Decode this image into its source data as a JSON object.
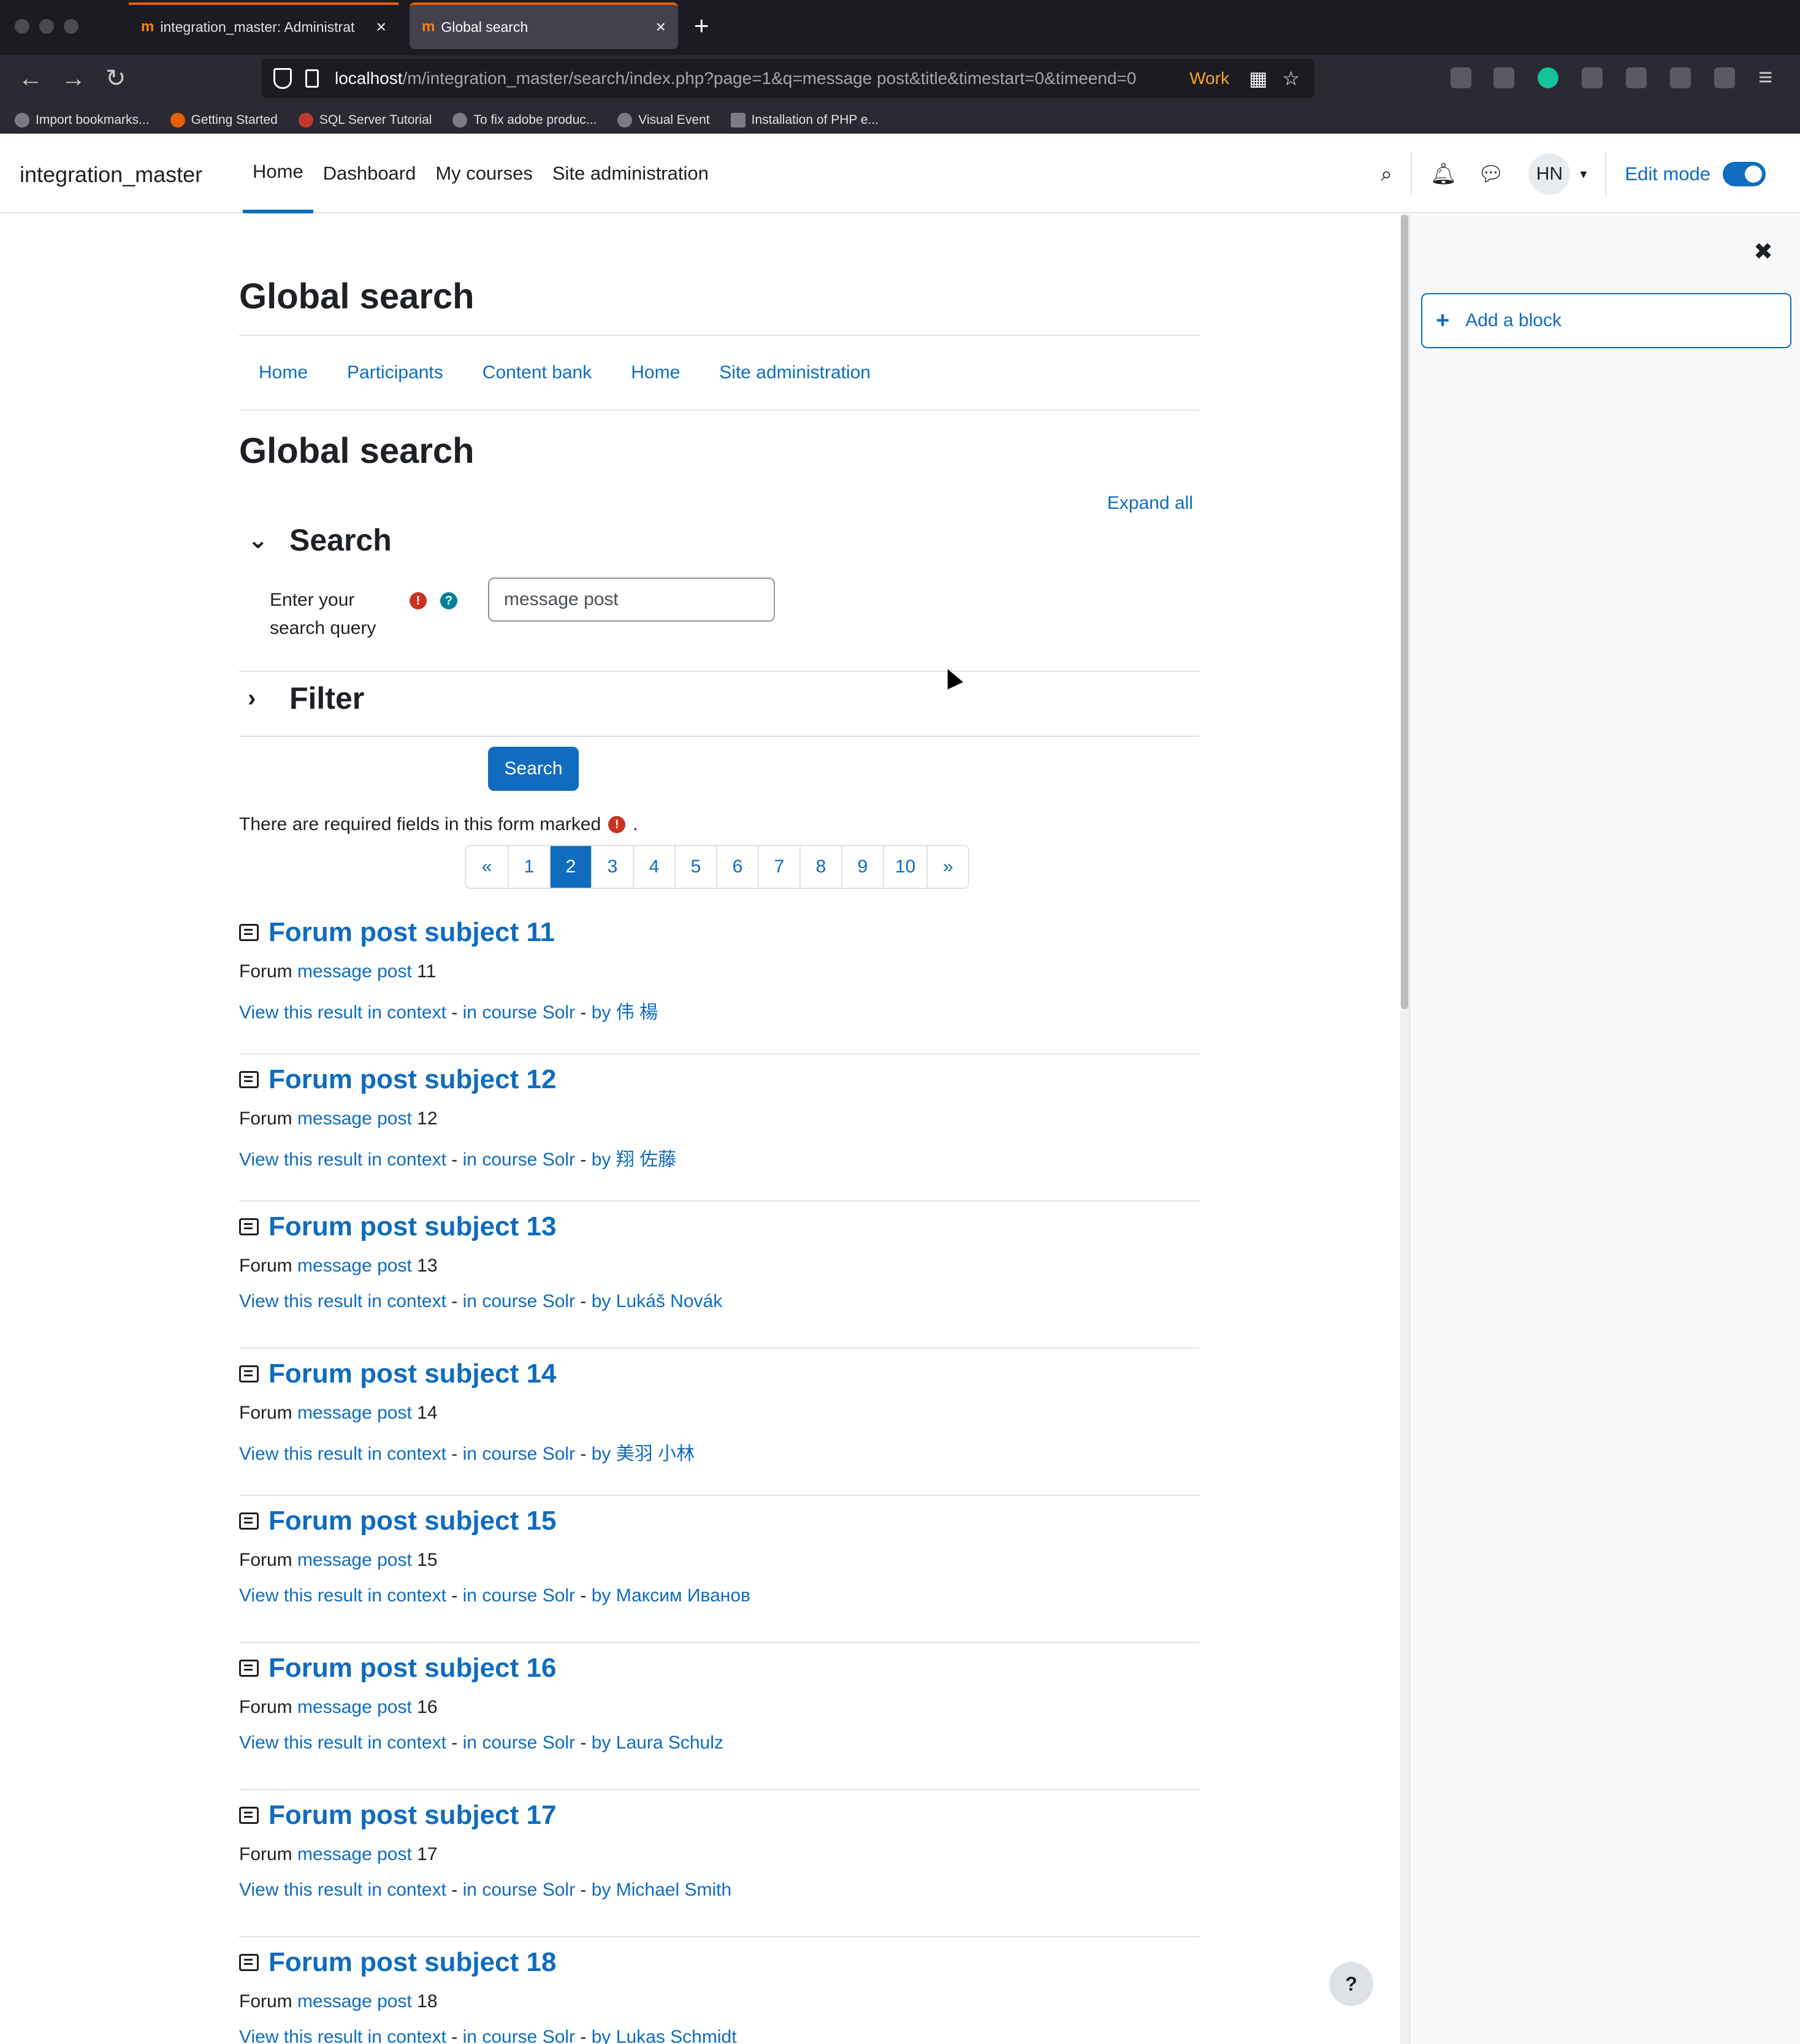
{
  "browser": {
    "tabs": [
      {
        "label": "integration_master: Administrat"
      },
      {
        "label": "Global search"
      }
    ],
    "url": {
      "host": "localhost",
      "path": "/m/integration_master/search/index.php?page=1&q=message post&title&timestart=0&timeend=0"
    },
    "container_label": "Work",
    "bookmarks": [
      {
        "label": "Import bookmarks..."
      },
      {
        "label": "Getting Started"
      },
      {
        "label": "SQL Server Tutorial"
      },
      {
        "label": "To fix adobe produc..."
      },
      {
        "label": "Visual Event"
      },
      {
        "label": "Installation of PHP e..."
      }
    ]
  },
  "header": {
    "site_name": "integration_master",
    "nav": [
      {
        "label": "Home"
      },
      {
        "label": "Dashboard"
      },
      {
        "label": "My courses"
      },
      {
        "label": "Site administration"
      }
    ],
    "user_initials": "HN",
    "edit_mode_label": "Edit mode"
  },
  "page": {
    "title": "Global search",
    "secondary_nav": [
      {
        "label": "Home"
      },
      {
        "label": "Participants"
      },
      {
        "label": "Content bank"
      },
      {
        "label": "Home"
      },
      {
        "label": "Site administration"
      }
    ],
    "heading": "Global search",
    "expand_all": "Expand all"
  },
  "form": {
    "search_section": "Search",
    "query_label": "Enter your search query",
    "query_value": "message post",
    "filter_section": "Filter",
    "submit_label": "Search",
    "required_note": "There are required fields in this form marked",
    "required_note_end": "."
  },
  "pagination": {
    "prev": "«",
    "pages": [
      "1",
      "2",
      "3",
      "4",
      "5",
      "6",
      "7",
      "8",
      "9",
      "10"
    ],
    "current": "2",
    "next": "»"
  },
  "results": [
    {
      "title": "Forum post subject 11",
      "prefix": "Forum",
      "match": "message post",
      "suffix": "11",
      "context_link": "View this result in context",
      "course": "in course Solr",
      "author": "by 伟 楊"
    },
    {
      "title": "Forum post subject 12",
      "prefix": "Forum",
      "match": "message post",
      "suffix": "12",
      "context_link": "View this result in context",
      "course": "in course Solr",
      "author": "by 翔 佐藤"
    },
    {
      "title": "Forum post subject 13",
      "prefix": "Forum",
      "match": "message post",
      "suffix": "13",
      "context_link": "View this result in context",
      "course": "in course Solr",
      "author": "by Lukáš Novák"
    },
    {
      "title": "Forum post subject 14",
      "prefix": "Forum",
      "match": "message post",
      "suffix": "14",
      "context_link": "View this result in context",
      "course": "in course Solr",
      "author": "by 美羽 小林"
    },
    {
      "title": "Forum post subject 15",
      "prefix": "Forum",
      "match": "message post",
      "suffix": "15",
      "context_link": "View this result in context",
      "course": "in course Solr",
      "author": "by Максим Иванов"
    },
    {
      "title": "Forum post subject 16",
      "prefix": "Forum",
      "match": "message post",
      "suffix": "16",
      "context_link": "View this result in context",
      "course": "in course Solr",
      "author": "by Laura Schulz"
    },
    {
      "title": "Forum post subject 17",
      "prefix": "Forum",
      "match": "message post",
      "suffix": "17",
      "context_link": "View this result in context",
      "course": "in course Solr",
      "author": "by Michael Smith"
    },
    {
      "title": "Forum post subject 18",
      "prefix": "Forum",
      "match": "message post",
      "suffix": "18",
      "context_link": "View this result in context",
      "course": "in course Solr",
      "author": "by Lukas Schmidt"
    }
  ],
  "drawer": {
    "add_block": "Add a block"
  },
  "help_button": "?"
}
